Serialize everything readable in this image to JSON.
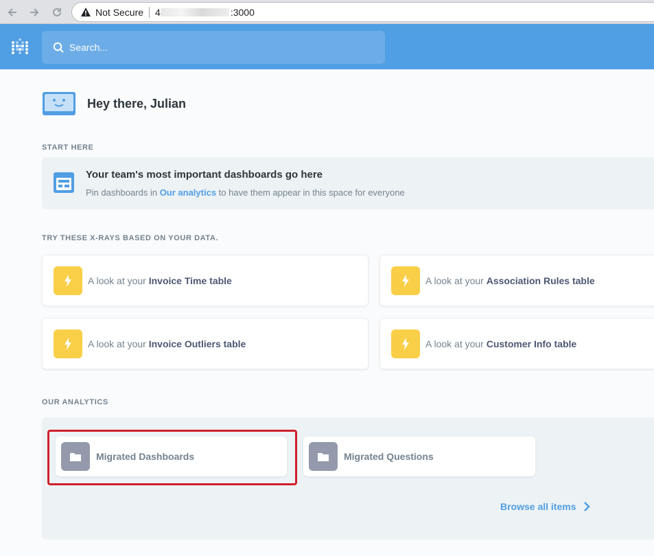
{
  "browser": {
    "security_label": "Not Secure",
    "url_prefix": "4",
    "url_suffix": ":3000"
  },
  "header": {
    "search_placeholder": "Search..."
  },
  "greeting": "Hey there, Julian",
  "start_here": {
    "title": "START HERE",
    "banner_title": "Your team's most important dashboards go here",
    "banner_sub_prefix": "Pin dashboards in ",
    "banner_sub_link": "Our analytics",
    "banner_sub_suffix": " to have them appear in this space for everyone"
  },
  "xrays": {
    "title": "TRY THESE X-RAYS BASED ON YOUR DATA.",
    "prefix": "A look at your ",
    "items": [
      {
        "name": "Invoice Time table"
      },
      {
        "name": "Association Rules table"
      },
      {
        "name": "Invoice Outliers table"
      },
      {
        "name": "Customer Info table"
      }
    ]
  },
  "analytics": {
    "title": "OUR ANALYTICS",
    "collections": [
      {
        "name": "Migrated Dashboards"
      },
      {
        "name": "Migrated Questions"
      }
    ],
    "browse_label": "Browse all items"
  },
  "colors": {
    "brand": "#509ee3",
    "xray_accent": "#f9cf48",
    "folder": "#949aab",
    "highlight": "#d0202a"
  }
}
